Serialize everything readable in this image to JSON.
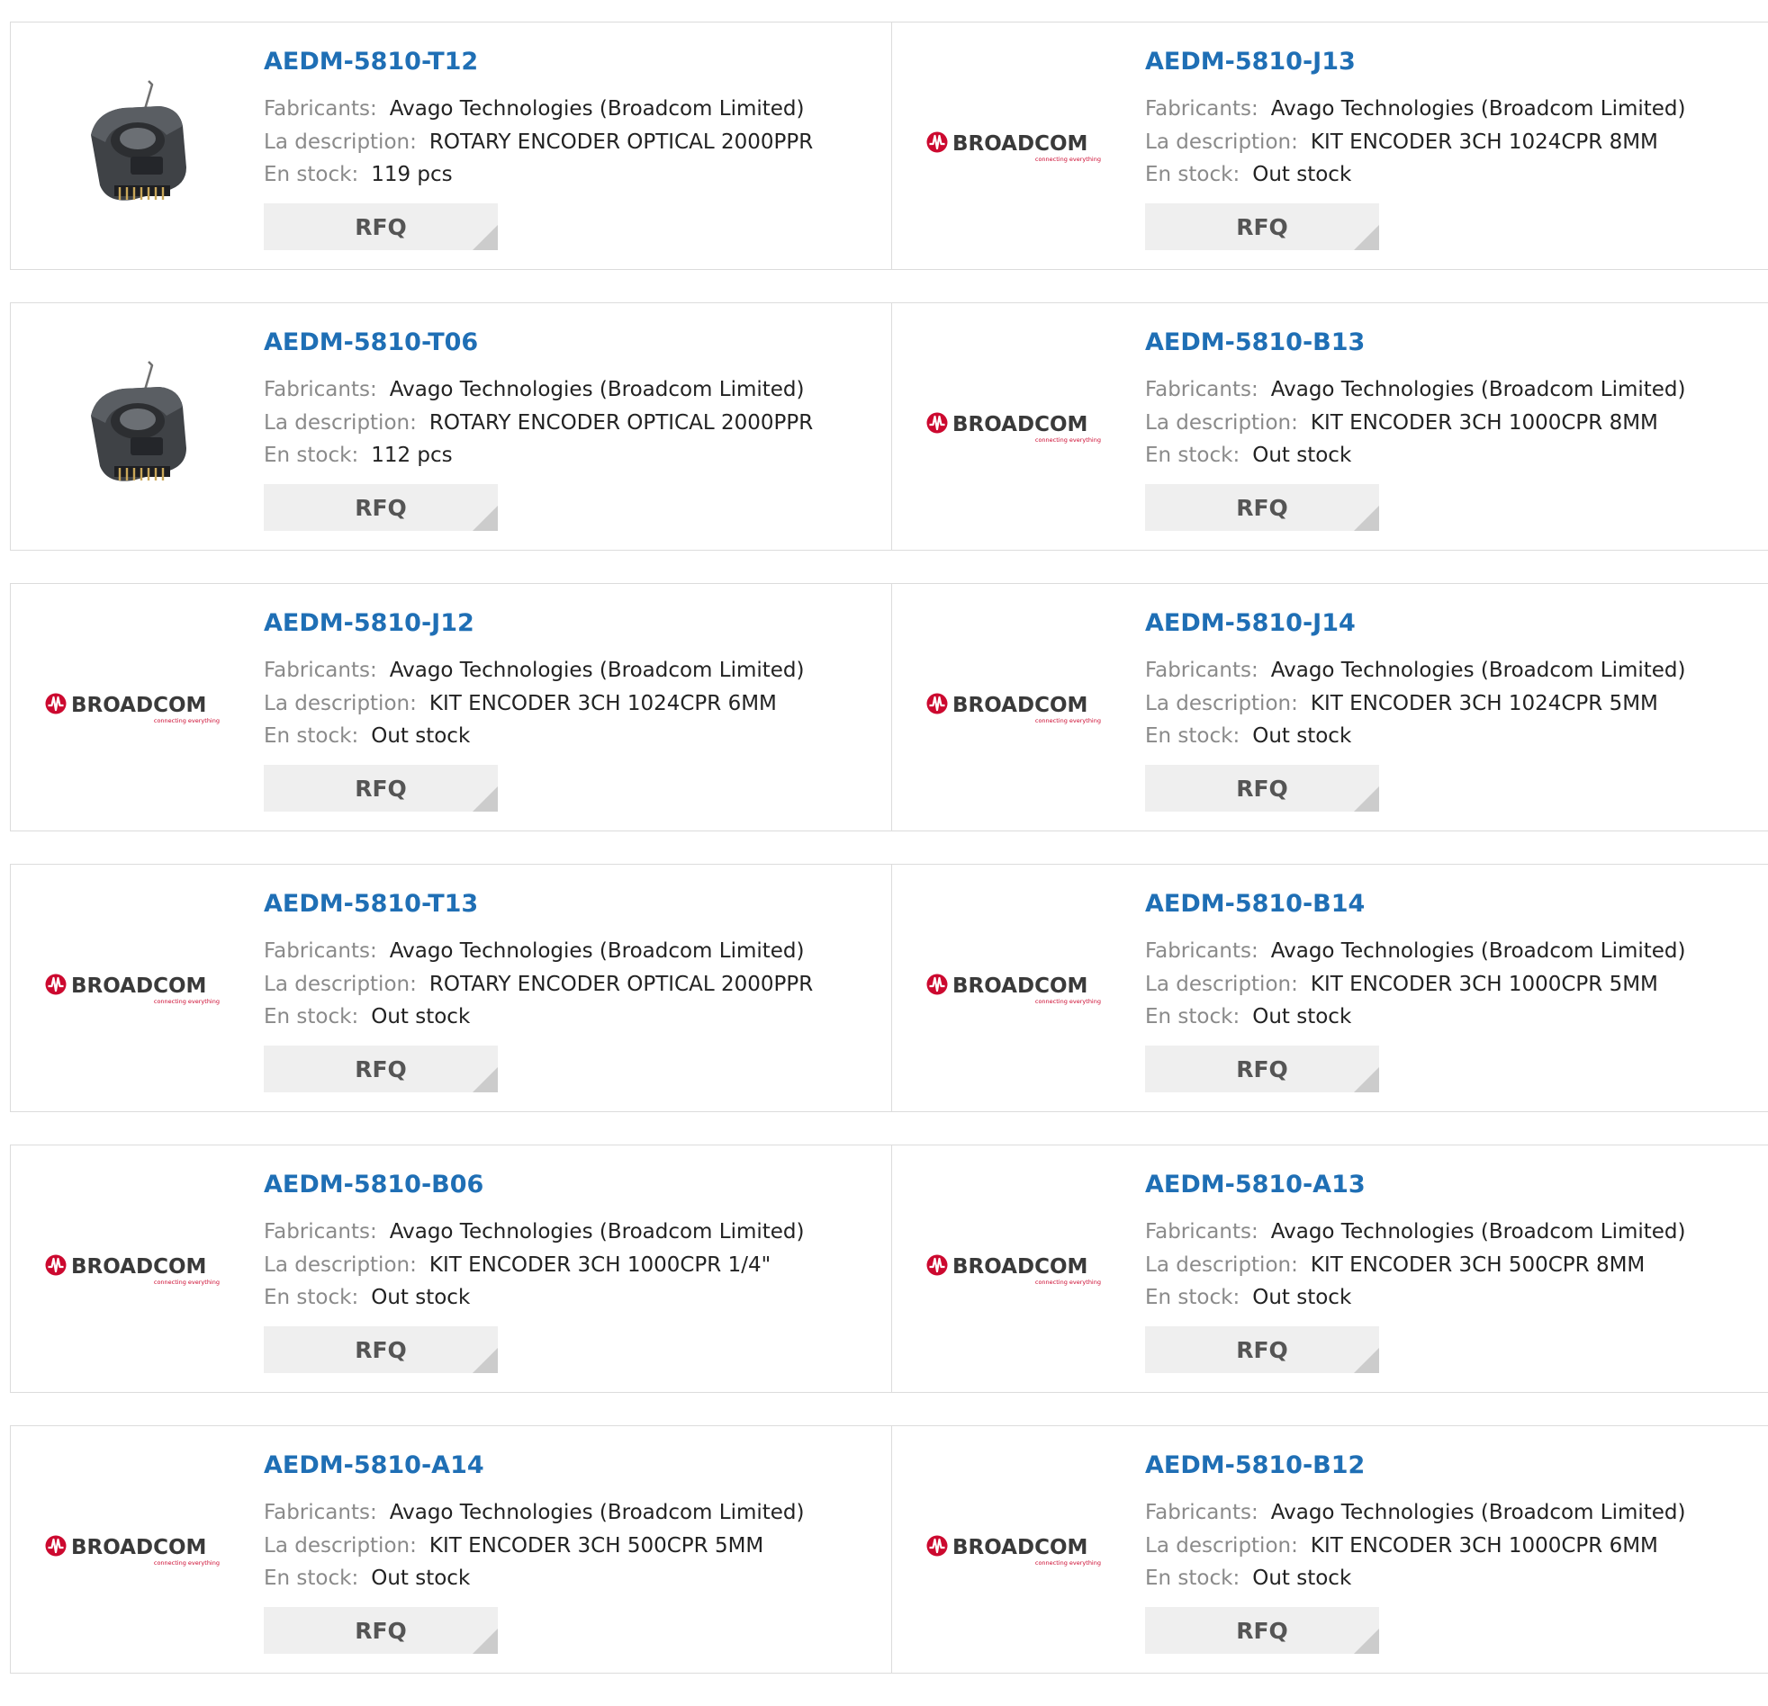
{
  "colors": {
    "link": "#1f6fb5",
    "label": "#8a8a8a",
    "value": "#222222",
    "broadcom_red": "#cc092f",
    "rfq_bg": "#efefef",
    "border": "#dcdcdc"
  },
  "labels": {
    "manufacturer": "Fabricants:",
    "description": "La description:",
    "stock": "En stock:",
    "rfq": "RFQ"
  },
  "brand": {
    "name": "BROADCOM",
    "tagline": "connecting everything"
  },
  "rows": [
    {
      "cards": [
        {
          "part": "AEDM-5810-T12",
          "manufacturer": "Avago Technologies (Broadcom Limited)",
          "description": "ROTARY ENCODER OPTICAL 2000PPR",
          "stock": "119 pcs",
          "image": "encoder-photo"
        },
        {
          "part": "AEDM-5810-J13",
          "manufacturer": "Avago Technologies (Broadcom Limited)",
          "description": "KIT ENCODER 3CH 1024CPR 8MM",
          "stock": "Out stock",
          "image": "broadcom-logo"
        }
      ]
    },
    {
      "cards": [
        {
          "part": "AEDM-5810-T06",
          "manufacturer": "Avago Technologies (Broadcom Limited)",
          "description": "ROTARY ENCODER OPTICAL 2000PPR",
          "stock": "112 pcs",
          "image": "encoder-photo"
        },
        {
          "part": "AEDM-5810-B13",
          "manufacturer": "Avago Technologies (Broadcom Limited)",
          "description": "KIT ENCODER 3CH 1000CPR 8MM",
          "stock": "Out stock",
          "image": "broadcom-logo"
        }
      ]
    },
    {
      "cards": [
        {
          "part": "AEDM-5810-J12",
          "manufacturer": "Avago Technologies (Broadcom Limited)",
          "description": "KIT ENCODER 3CH 1024CPR 6MM",
          "stock": "Out stock",
          "image": "broadcom-logo"
        },
        {
          "part": "AEDM-5810-J14",
          "manufacturer": "Avago Technologies (Broadcom Limited)",
          "description": "KIT ENCODER 3CH 1024CPR 5MM",
          "stock": "Out stock",
          "image": "broadcom-logo"
        }
      ]
    },
    {
      "cards": [
        {
          "part": "AEDM-5810-T13",
          "manufacturer": "Avago Technologies (Broadcom Limited)",
          "description": "ROTARY ENCODER OPTICAL 2000PPR",
          "stock": "Out stock",
          "image": "broadcom-logo"
        },
        {
          "part": "AEDM-5810-B14",
          "manufacturer": "Avago Technologies (Broadcom Limited)",
          "description": "KIT ENCODER 3CH 1000CPR 5MM",
          "stock": "Out stock",
          "image": "broadcom-logo"
        }
      ]
    },
    {
      "cards": [
        {
          "part": "AEDM-5810-B06",
          "manufacturer": "Avago Technologies (Broadcom Limited)",
          "description": "KIT ENCODER 3CH 1000CPR 1/4\"",
          "stock": "Out stock",
          "image": "broadcom-logo"
        },
        {
          "part": "AEDM-5810-A13",
          "manufacturer": "Avago Technologies (Broadcom Limited)",
          "description": "KIT ENCODER 3CH 500CPR 8MM",
          "stock": "Out stock",
          "image": "broadcom-logo"
        }
      ]
    },
    {
      "cards": [
        {
          "part": "AEDM-5810-A14",
          "manufacturer": "Avago Technologies (Broadcom Limited)",
          "description": "KIT ENCODER 3CH 500CPR 5MM",
          "stock": "Out stock",
          "image": "broadcom-logo"
        },
        {
          "part": "AEDM-5810-B12",
          "manufacturer": "Avago Technologies (Broadcom Limited)",
          "description": "KIT ENCODER 3CH 1000CPR 6MM",
          "stock": "Out stock",
          "image": "broadcom-logo"
        }
      ]
    }
  ]
}
